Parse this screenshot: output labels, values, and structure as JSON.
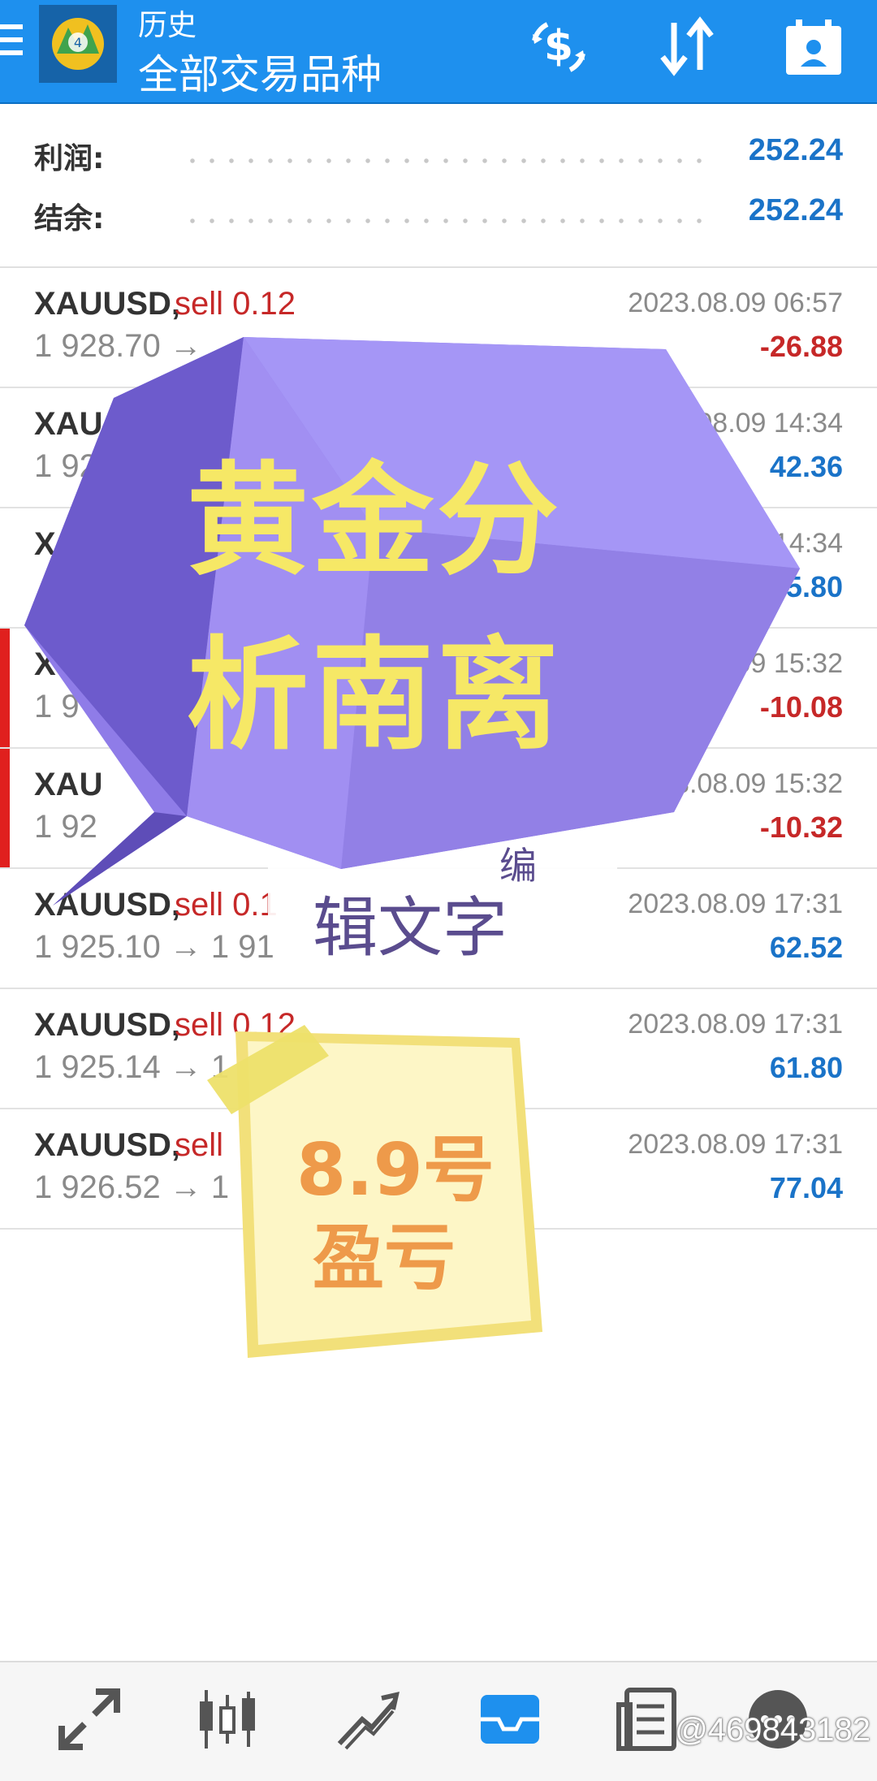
{
  "header": {
    "subtitle": "历史",
    "title": "全部交易品种"
  },
  "summary": {
    "profit_label": "利润:",
    "profit_value": "252.24",
    "balance_label": "结余:",
    "balance_value": "252.24"
  },
  "trades": [
    {
      "symbol": "XAUUSD,",
      "side": "sell 0.12",
      "prices": "1 928.70 →",
      "time": "2023.08.09 06:57",
      "profit": "-26.88",
      "flag": false
    },
    {
      "symbol": "XAU",
      "side": "",
      "prices": "1 92",
      "time": ".08.09 14:34",
      "profit": "42.36",
      "flag": false
    },
    {
      "symbol": "X",
      "side": "",
      "prices": "",
      "time": "14:34",
      "profit": "5.80",
      "flag": false
    },
    {
      "symbol": "X",
      "side": "",
      "prices": "1 9",
      "time": "09 15:32",
      "profit": "-10.08",
      "flag": true
    },
    {
      "symbol": "XAU",
      "side": "",
      "prices": "1 92",
      "time": "3.08.09 15:32",
      "profit": "-10.32",
      "flag": true
    },
    {
      "symbol": "XAUUSD,",
      "side": "sell 0.1",
      "prices": "1 925.10 → 1 91",
      "time": "2023.08.09 17:31",
      "profit": "62.52",
      "flag": false
    },
    {
      "symbol": "XAUUSD,",
      "side": "sell 0.12",
      "prices": "1 925.14 → 1",
      "time": "2023.08.09 17:31",
      "profit": "61.80",
      "flag": false
    },
    {
      "symbol": "XAUUSD,",
      "side": "sell",
      "prices": "1 926.52 → 1",
      "time": "2023.08.09 17:31",
      "profit": "77.04",
      "flag": false
    }
  ],
  "overlay": {
    "line1": "黄金分",
    "line2": "析南离",
    "edit_fragment": "编",
    "edit_text": "辑文字",
    "note_line1": "8.9号",
    "note_line2": "盈亏"
  },
  "watermark": "@469843182",
  "colors": {
    "appbar": "#1e90ee",
    "loss": "#c62828",
    "gain": "#1a73c8",
    "flag": "#e0201e",
    "gem": "#9a87f0",
    "gem_text": "#f6e866",
    "note": "#fdf6c6",
    "note_text": "#ee9a4a"
  },
  "icons": {
    "menu": "hamburger-icon",
    "logo": "metatrader-logo",
    "currency": "currency-exchange-icon",
    "sort": "sort-icon",
    "calendar": "calendar-contact-icon",
    "nav": [
      "quotes-icon",
      "chart-icon",
      "trade-icon",
      "history-icon",
      "news-icon",
      "chat-icon"
    ]
  }
}
